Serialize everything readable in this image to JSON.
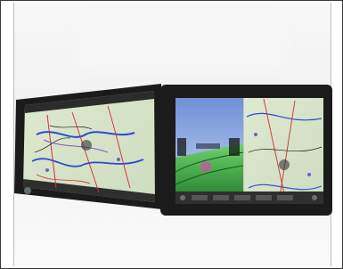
{
  "scene": {
    "description_icon_left": "tablet-moving-map-icon",
    "description_icon_right": "tablet-synthetic-vision-icon"
  }
}
